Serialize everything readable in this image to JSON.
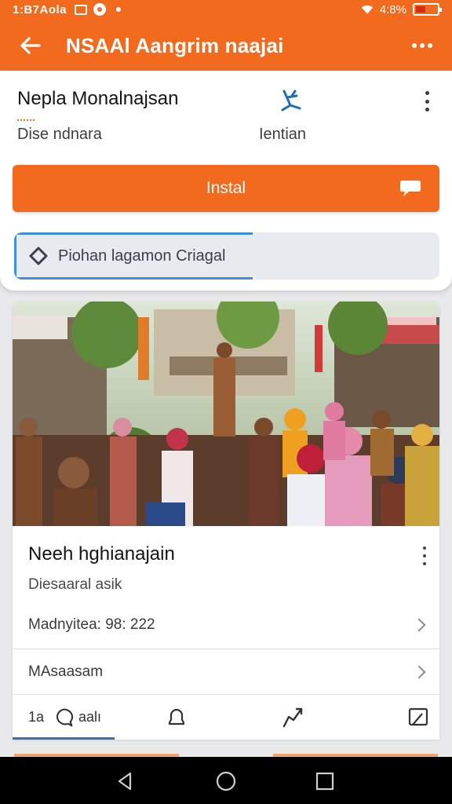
{
  "status_bar": {
    "time": "1:B7Aola",
    "battery_text": "4:8%",
    "battery_level": 0.46,
    "icons": [
      "mail-icon",
      "notification-circle-icon",
      "dot-icon",
      "wifi-icon",
      "battery-icon"
    ]
  },
  "app_bar": {
    "title": "NSAAl Aangrim naajai",
    "back_icon": "arrow-left-icon",
    "menu_icon": "more-horizontal-icon"
  },
  "app_card": {
    "name": "Nepla Monalnajsan",
    "subtitle": "Dise ndnara",
    "meta": "Ientian",
    "accent_icon": "stick-figure-icon",
    "menu_icon": "more-vertical-icon"
  },
  "install_button": {
    "label": "Instal",
    "icon": "chat-bubble-icon"
  },
  "search": {
    "value": "Piohan lagamon Criagal",
    "icon": "tag-icon",
    "focus_progress": 0.56
  },
  "post": {
    "image_description": "crowd of people outdoors",
    "title": "Neeh hghianajain",
    "subtitle": "Diesaaral asik",
    "rows": [
      {
        "label": "Madnyitea: 98: 222"
      },
      {
        "label": "MAsaasam"
      }
    ],
    "actions": {
      "comment_count": "1a",
      "comment_label": "aalı",
      "icons": [
        "comment-icon",
        "bell-icon",
        "share-icon",
        "flag-icon"
      ]
    }
  },
  "nav_bar": {
    "icons": [
      "nav-back-icon",
      "nav-home-icon",
      "nav-recent-icon"
    ]
  },
  "colors": {
    "accent": "#f26a1e",
    "focus": "#3e8ee0",
    "background": "#e9e9ec"
  }
}
